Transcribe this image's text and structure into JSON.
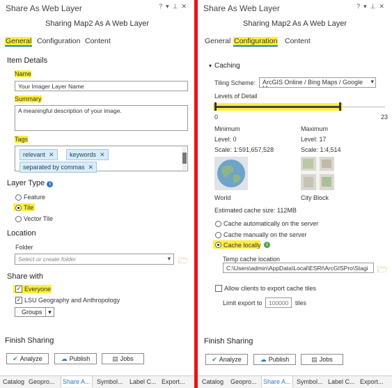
{
  "left": {
    "title": "Share As Web Layer",
    "window_controls": [
      "?",
      "▾",
      "⊥",
      "✕"
    ],
    "subtitle": "Sharing Map2 As A Web Layer",
    "tabs": [
      "General",
      "Configuration",
      "Content"
    ],
    "item_details": {
      "heading": "Item Details",
      "name_label": "Name",
      "name_value": "Your Imager Layer Name",
      "summary_label": "Summary",
      "summary_value": "A meaningful description of your image.",
      "tags_label": "Tags",
      "tags": [
        "relevant",
        "keywords",
        "separated by commas"
      ]
    },
    "layer_type": {
      "heading": "Layer Type",
      "options": [
        "Feature",
        "Tile",
        "Vector Tile"
      ],
      "selected": "Tile"
    },
    "location": {
      "heading": "Location",
      "folder_label": "Folder",
      "folder_placeholder": "Select or create folder"
    },
    "share_with": {
      "heading": "Share with",
      "everyone": "Everyone",
      "group": "LSU Geography and Anthropology",
      "groups_button": "Groups"
    },
    "finish": {
      "heading": "Finish Sharing",
      "analyze": "Analyze",
      "publish": "Publish",
      "jobs": "Jobs"
    },
    "bottom_tabs": [
      "Catalog",
      "Geopro...",
      "Share A...",
      "Symbol...",
      "Label C...",
      "Export..."
    ]
  },
  "right": {
    "title": "Share As Web Layer",
    "window_controls": [
      "?",
      "▾",
      "⊥",
      "✕"
    ],
    "subtitle": "Sharing Map2 As A Web Layer",
    "tabs": [
      "General",
      "Configuration",
      "Content"
    ],
    "caching": {
      "heading": "Caching",
      "tiling_scheme_label": "Tiling Scheme:",
      "tiling_scheme_value": "ArcGIS Online / Bing Maps / Google Ma",
      "levels_label": "Levels of Detail",
      "slider_min": "0",
      "slider_max": "23",
      "slider_start_level": 0,
      "slider_end_level": 17,
      "minimum": {
        "heading": "Minimum",
        "level": "Level:  0",
        "scale": "Scale:  1:591,657,528",
        "caption": "World"
      },
      "maximum": {
        "heading": "Maximum",
        "level": "Level:  17",
        "scale": "Scale:  1:4,514",
        "caption": "City Block"
      },
      "estimated": "Estimated cache size:   112MB",
      "options": [
        "Cache automatically on the server",
        "Cache manually on the server",
        "Cache locally"
      ],
      "selected": "Cache locally",
      "temp_label": "Temp cache location",
      "temp_value": "C:\\Users\\admin\\AppData\\Local\\ESRI\\ArcGISPro\\Stagi",
      "export_label": "Allow clients to export cache tiles",
      "limit_label": "Limit export to",
      "limit_value": "100000",
      "limit_unit": "tiles"
    },
    "finish": {
      "heading": "Finish Sharing",
      "analyze": "Analyze",
      "publish": "Publish",
      "jobs": "Jobs"
    },
    "bottom_tabs": [
      "Catalog",
      "Geopro...",
      "Share A...",
      "Symbol...",
      "Label C...",
      "Export..."
    ]
  },
  "colors": {
    "highlight": "#ffef3a",
    "accent": "#2a7ac6",
    "divider": "#ee1111",
    "success": "#2e9b2e"
  }
}
